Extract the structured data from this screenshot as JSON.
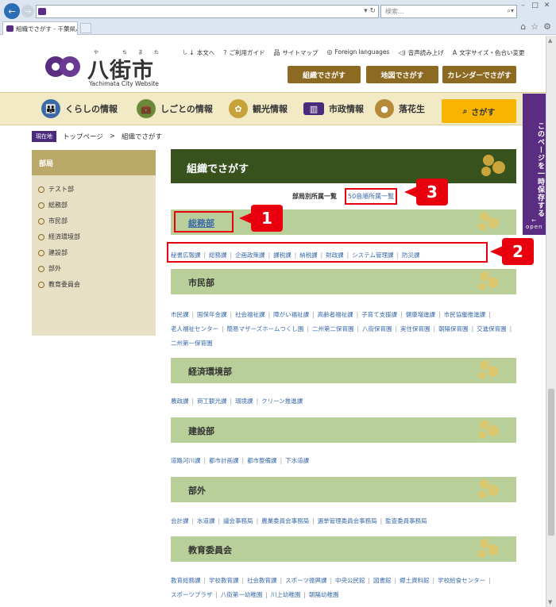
{
  "browser": {
    "tab_title": "組織でさがす - 千葉県八...",
    "search_placeholder": "検索..."
  },
  "site": {
    "name": "八街市",
    "name_ruby": "や ちまた し",
    "name_en": "Yachimata City Website"
  },
  "utility": [
    {
      "icon": "↓",
      "label": "本文へ"
    },
    {
      "icon": "?",
      "label": "ご利用ガイド"
    },
    {
      "icon": "品",
      "label": "サイトマップ"
    },
    {
      "icon": "◎",
      "label": "Foreign languages"
    },
    {
      "icon": "◁)",
      "label": "音声読み上げ"
    },
    {
      "icon": "A",
      "label": "文字サイズ・色合い変更"
    }
  ],
  "header_buttons": [
    "組織でさがす",
    "地図でさがす",
    "カレンダーでさがす"
  ],
  "global_nav": [
    "くらしの情報",
    "しごとの情報",
    "観光情報",
    "市政情報",
    "落花生"
  ],
  "global_search": "さがす",
  "side_tab": {
    "label": "このページを一時保存する",
    "open": "open"
  },
  "breadcrumb": {
    "now": "現在地",
    "top": "トップページ",
    "sep": ">",
    "current": "組織でさがす"
  },
  "sidebar": {
    "heading": "部局",
    "items": [
      "テスト部",
      "総務部",
      "市民部",
      "経済環境部",
      "建設部",
      "部外",
      "教育委員会"
    ]
  },
  "page_title": "組織でさがす",
  "subnav": {
    "current": "部局別所属一覧",
    "link": "50音順所属一覧"
  },
  "sections": [
    {
      "name": "総務部",
      "links": [
        "秘書広報課",
        "総務課",
        "企画政策課",
        "課税課",
        "納税課",
        "財政課",
        "システム管理課",
        "防災課"
      ]
    },
    {
      "name": "市民部",
      "links": [
        "市民課",
        "国保年金課",
        "社会福祉課",
        "障がい福祉課",
        "高齢者福祉課",
        "子育て支援課",
        "健康増進課",
        "市民協働推進課",
        "老人福祉センター",
        "簡易マザーズホームつくし園",
        "二州第二保育園",
        "八街保育園",
        "実住保育園",
        "朝陽保育園",
        "交進保育園",
        "二州第一保育園"
      ]
    },
    {
      "name": "経済環境部",
      "links": [
        "農政課",
        "商工観光課",
        "環境課",
        "クリーン推進課"
      ]
    },
    {
      "name": "建設部",
      "links": [
        "道路河川課",
        "都市計画課",
        "都市整備課",
        "下水道課"
      ]
    },
    {
      "name": "部外",
      "links": [
        "会計課",
        "水道課",
        "議会事務局",
        "農業委員会事務局",
        "選挙管理委員会事務局",
        "監査委員事務局"
      ]
    },
    {
      "name": "教育委員会",
      "links": [
        "教育総務課",
        "学校教育課",
        "社会教育課",
        "スポーツ振興課",
        "中央公民館",
        "図書館",
        "郷土資料館",
        "学校給食センター",
        "スポーツプラザ",
        "八街第一幼稚園",
        "川上幼稚園",
        "朝陽幼稚園"
      ]
    }
  ],
  "callouts": [
    "1",
    "2",
    "3"
  ]
}
